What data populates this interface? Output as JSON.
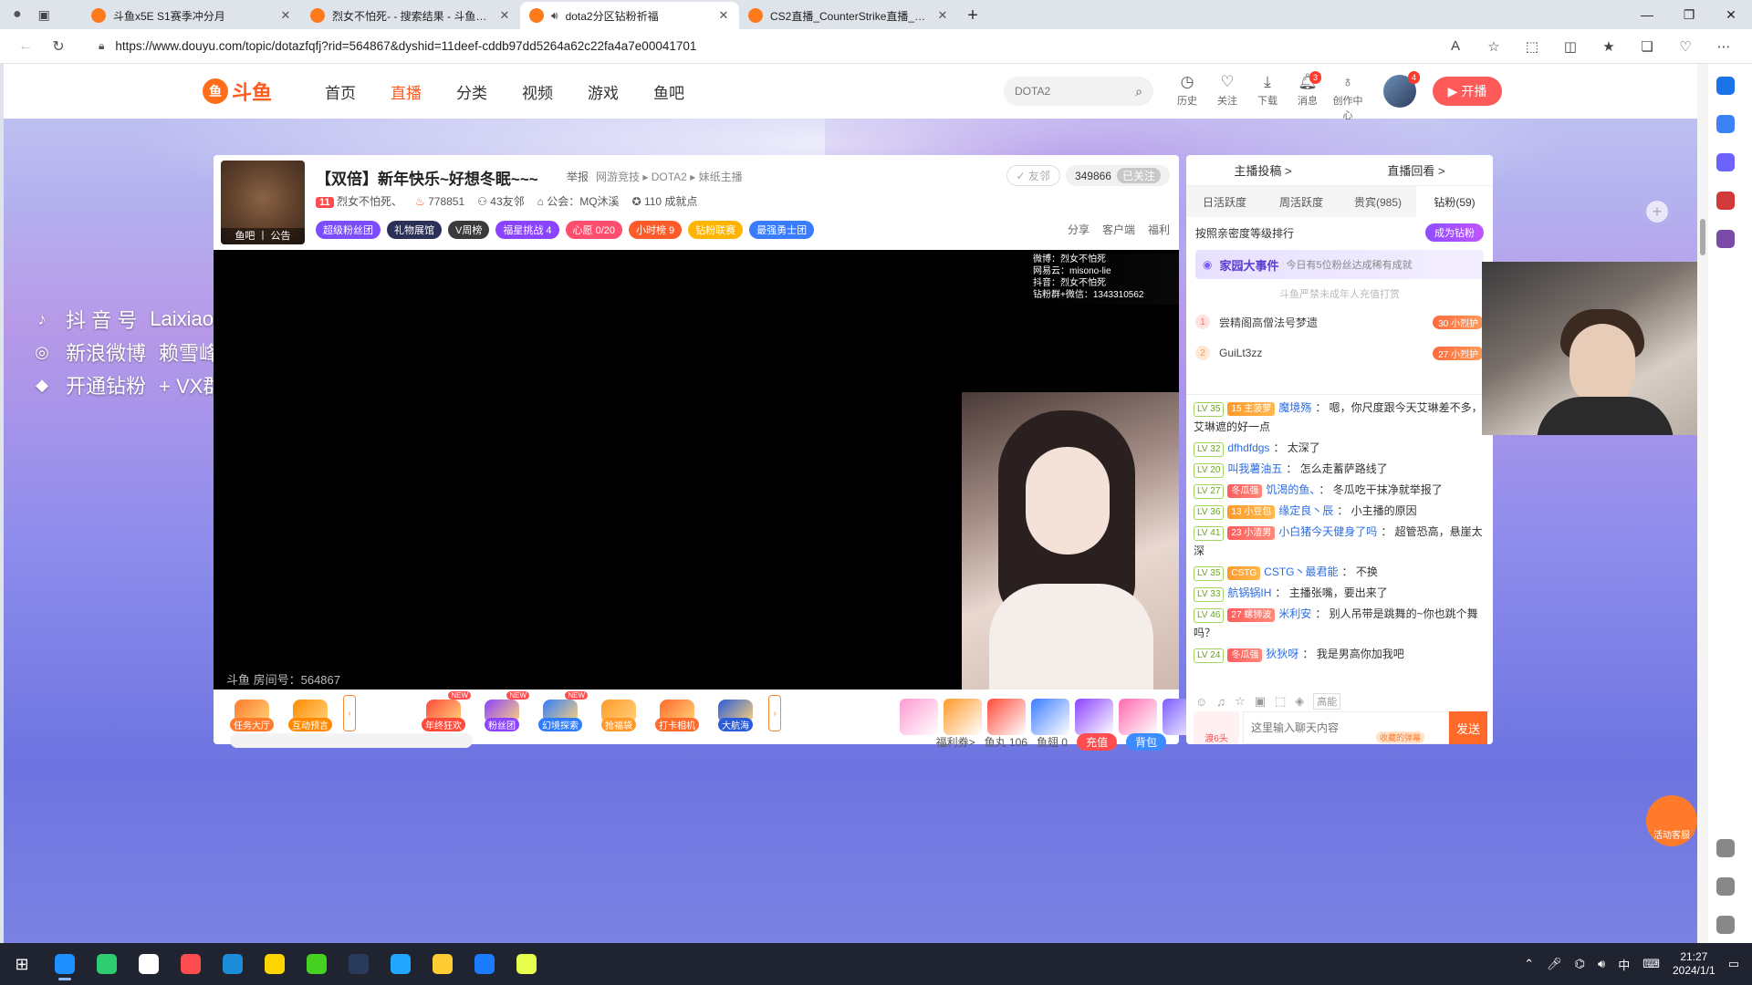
{
  "browser": {
    "tabs": [
      {
        "title": "斗鱼x5E S1赛季冲分月",
        "active": false,
        "favicon": "#ff7a1a"
      },
      {
        "title": "烈女不怕死- - 搜索结果 - 斗鱼直播",
        "active": false,
        "favicon": "#ff7a1a"
      },
      {
        "title": "dota2分区钻粉祈福",
        "active": true,
        "favicon": "#ff7a1a"
      },
      {
        "title": "CS2直播_CounterStrike直播_CS2",
        "active": false,
        "favicon": "#ff7a1a"
      }
    ],
    "url": "https://www.douyu.com/topic/dotazfqfj?rid=564867&dyshid=11deef-cddb97dd5264a62c22fa4a7e00041701"
  },
  "header": {
    "logo_text": "斗鱼",
    "nav": [
      "首页",
      "直播",
      "分类",
      "视频",
      "游戏",
      "鱼吧"
    ],
    "active_nav": "直播",
    "search_placeholder": "DOTA2",
    "tools": [
      {
        "label": "历史",
        "icon": "clock-icon",
        "badge": ""
      },
      {
        "label": "关注",
        "icon": "heart-icon",
        "badge": ""
      },
      {
        "label": "下载",
        "icon": "download-icon",
        "badge": ""
      },
      {
        "label": "消息",
        "icon": "bell-icon",
        "badge": "3"
      },
      {
        "label": "创作中心",
        "icon": "bulb-icon",
        "badge": ""
      }
    ],
    "avatar_badge": "4",
    "golive_label": "开播"
  },
  "overlay": {
    "rows": [
      {
        "label": "抖 音 号",
        "value": "Laixiaofeng",
        "icon": "tiktok-icon"
      },
      {
        "label": "新浪微博",
        "value": "赖雪峰xf",
        "icon": "weibo-icon"
      },
      {
        "label": "开通钻粉",
        "value": "+ VX群",
        "icon": "diamond-icon"
      }
    ]
  },
  "room": {
    "title": "【双倍】新年快乐~好想冬眠~~~",
    "report": "举报",
    "breadcrumb": [
      "网游竞技",
      "DOTA2",
      "妹纸主播"
    ],
    "avatar_label": "鱼吧 丨 公告",
    "level": "11",
    "anchor_name": "烈女不怕死、",
    "hot": "778851",
    "friends": "43友邻",
    "guild": "公会：MQ沐溪",
    "achievements": "110 成就点",
    "friend_btn": "友邻",
    "followers": "349866",
    "followed_btn": "已关注",
    "tags": [
      {
        "label": "超级粉丝团",
        "color": "#7b4dff"
      },
      {
        "label": "礼物展馆",
        "color": "#2c2f57"
      },
      {
        "label": "V周榜",
        "color": "#3a3a3a"
      },
      {
        "label": "福星挑战  4",
        "color": "#8a43ff"
      },
      {
        "label": "心愿    0/20",
        "color": "#ff4d6d"
      },
      {
        "label": "小时榜  9",
        "color": "#ff5a2a"
      },
      {
        "label": "钻粉联赛",
        "color": "#ffb400"
      },
      {
        "label": "最强勇士团",
        "color": "#3a7cff"
      }
    ],
    "tools": [
      "分享",
      "客户端",
      "福利"
    ],
    "watermark": "斗鱼 房间号：564867",
    "corner_lines": [
      "微博：烈女不怕死",
      "网易云：misono-lie",
      "抖音：烈女不怕死",
      "钻粉群+微信：1343310562"
    ]
  },
  "gifts": [
    {
      "label": "任务大厅",
      "color": "#ff7a2a",
      "new": false
    },
    {
      "label": "互动预言",
      "color": "#ff8a00",
      "new": false
    },
    {
      "label": "年终狂欢",
      "color": "#ff4a3a",
      "new": true
    },
    {
      "label": "粉丝团",
      "color": "#8a43ff",
      "new": true
    },
    {
      "label": "幻境探索",
      "color": "#2f7cff",
      "new": true
    },
    {
      "label": "抢福袋",
      "color": "#ff9a2a",
      "new": false
    },
    {
      "label": "打卡相机",
      "color": "#ff6a2a",
      "new": false
    },
    {
      "label": "大航海",
      "color": "#2a5bd8",
      "new": false
    }
  ],
  "wallet": {
    "coupon": "福利券>",
    "fishball": "鱼丸 106",
    "fishfin": "鱼翅 0",
    "recharge": "充值",
    "bag": "背包"
  },
  "side": {
    "top_links": [
      "主播投稿 >",
      "直播回看 >"
    ],
    "tabs": [
      "日活跃度",
      "周活跃度",
      "贵宾(985)",
      "钻粉(59)"
    ],
    "rank_title": "按照亲密度等级排行",
    "become_btn": "成为钻粉",
    "event_title": "家园大事件",
    "event_sub": "今日有5位粉丝达成稀有成就",
    "notice": "斗鱼严禁未成年人充值打赏",
    "ranking": [
      {
        "rank": "1",
        "name": "尝精阁高僧法号梦遗",
        "fan": "30 小烈护"
      },
      {
        "rank": "2",
        "name": "GuiLt3zz",
        "fan": "27 小烈护"
      }
    ],
    "messages": [
      {
        "lv": "LV 35",
        "badge": "15 主菠萝",
        "badge_style": "",
        "user": "魔境殇",
        "text": "嗯，你尺度跟今天艾琳差不多，艾琳遮的好一点"
      },
      {
        "lv": "LV 32",
        "badge": "",
        "badge_style": "",
        "user": "dfhdfdgs",
        "text": "太深了"
      },
      {
        "lv": "LV 20",
        "badge": "",
        "badge_style": "",
        "user": "叫我薯油五",
        "text": "怎么走蓄萨路线了"
      },
      {
        "lv": "LV 27",
        "badge": "冬瓜强",
        "badge_style": "red",
        "user": "饥渴的鱼、",
        "text": "冬瓜吃干抹净就举报了"
      },
      {
        "lv": "LV 36",
        "badge": "13 小豆包",
        "badge_style": "",
        "user": "缘定良丶辰",
        "text": "小主播的原因"
      },
      {
        "lv": "LV 41",
        "badge": "23 小渣男",
        "badge_style": "red",
        "user": "小白猪今天健身了吗",
        "text": "超管恐高，悬崖太深"
      },
      {
        "lv": "LV 35",
        "badge": "CSTG",
        "badge_style": "",
        "user": "CSTG丶最君能",
        "text": "不换"
      },
      {
        "lv": "LV 33",
        "badge": "",
        "badge_style": "",
        "user": "航锅锅IH",
        "text": "主播张嘴，要出来了"
      },
      {
        "lv": "LV 46",
        "badge": "27 螺狮波",
        "badge_style": "red",
        "user": "米利安",
        "text": "别人吊带是跳舞的~你也跳个舞吗？"
      },
      {
        "lv": "LV 24",
        "badge": "冬瓜强",
        "badge_style": "red",
        "user": "狄狄呀",
        "text": "我是男高你加我吧"
      }
    ],
    "chat_placeholder": "这里输入聊天内容",
    "collect": "收藏的弹幕",
    "send": "发送",
    "avatar_label": "渡6头",
    "tool_label": "高能"
  },
  "float": {
    "service": "活动客服",
    "plus": "+"
  },
  "taskbar": {
    "apps": [
      "#1e90ff",
      "#2ecc71",
      "#ffffff",
      "#ff4d4f",
      "#1b8cd8",
      "#ffd400",
      "#44d11f",
      "#2a3a5a",
      "#23a6ff",
      "#ffcc33",
      "#1c7cff",
      "#e8ff4d"
    ],
    "time": "21:27",
    "date": "2024/1/1",
    "ime": "中"
  }
}
